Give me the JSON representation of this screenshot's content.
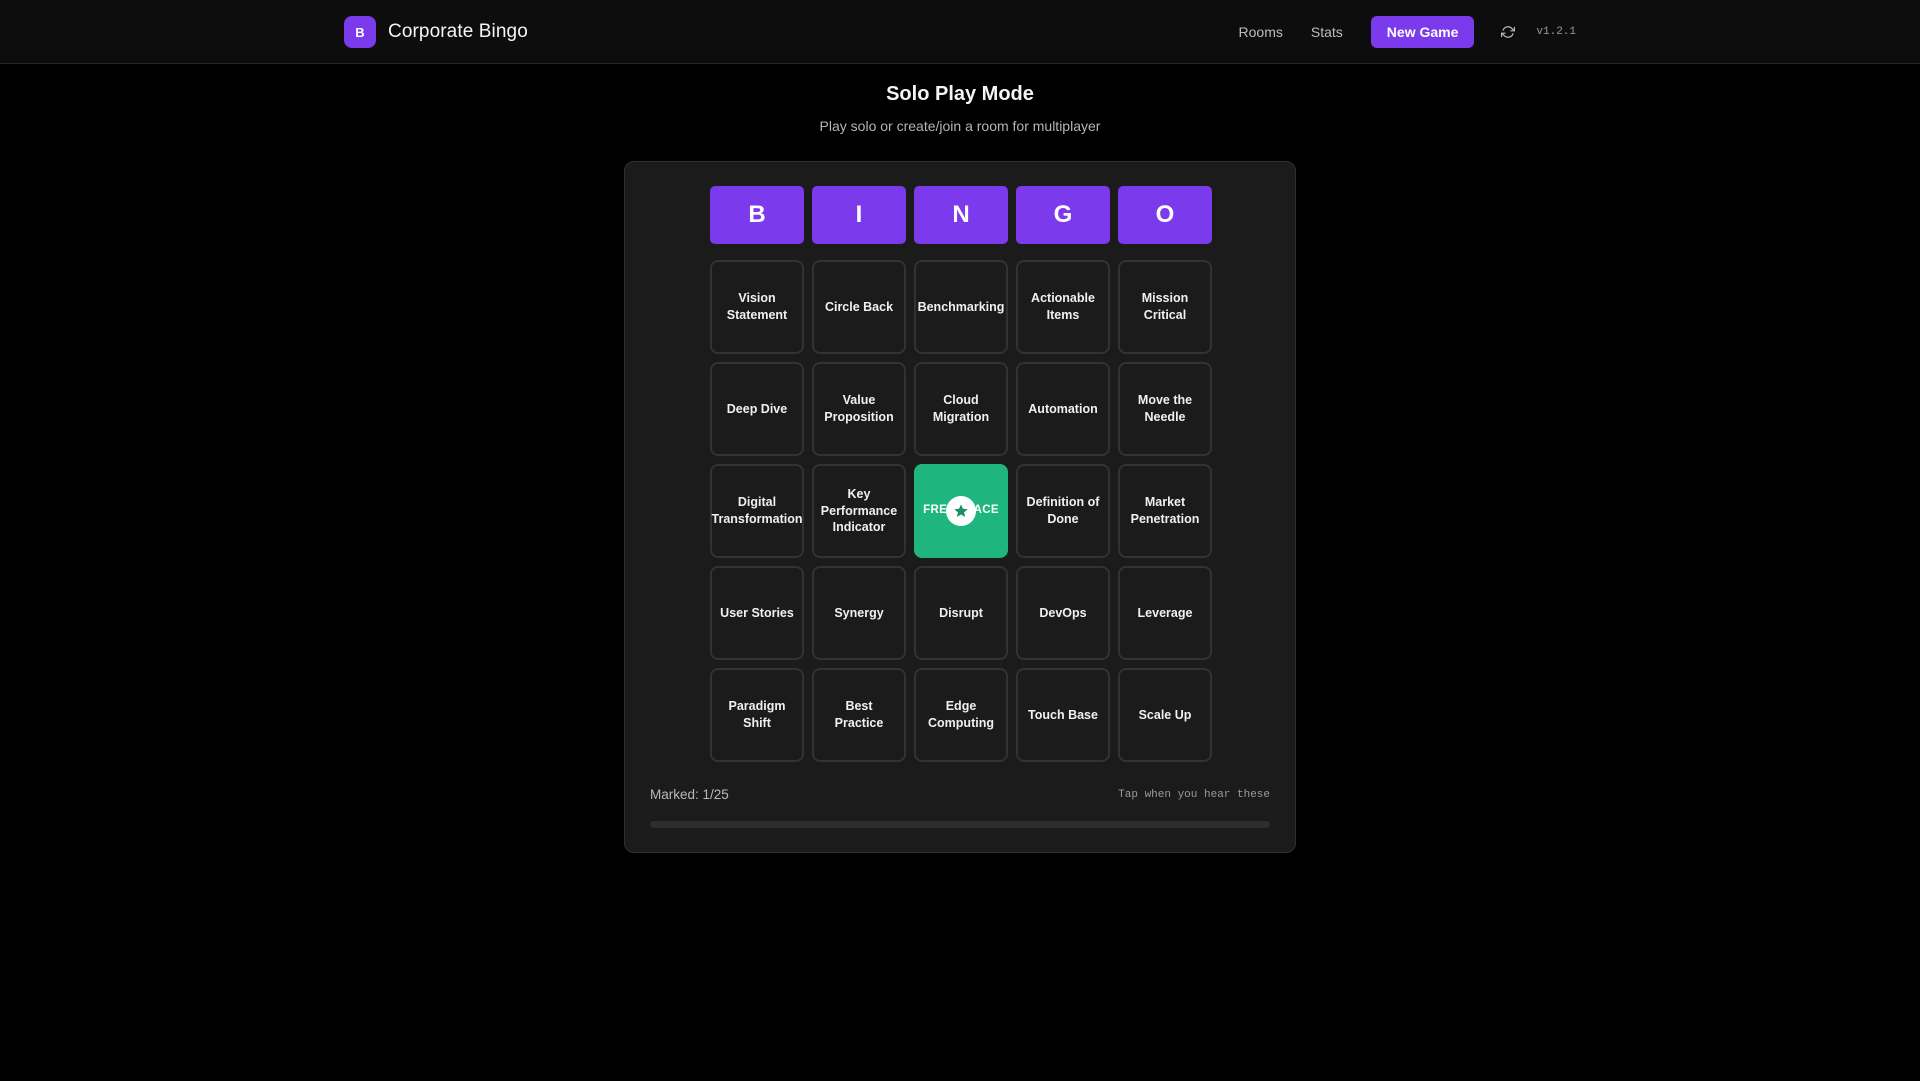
{
  "header": {
    "logo_letter": "B",
    "app_title": "Corporate Bingo",
    "nav": {
      "rooms": "Rooms",
      "stats": "Stats",
      "new_game": "New Game",
      "refresh_icon": "refresh-icon",
      "version": "v1.2.1"
    }
  },
  "page": {
    "title": "Solo Play Mode",
    "subtitle": "Play solo or create/join a room for multiplayer"
  },
  "board": {
    "letters": [
      "B",
      "I",
      "N",
      "G",
      "O"
    ],
    "cells": [
      {
        "label": "Vision Statement",
        "marked": false
      },
      {
        "label": "Circle Back",
        "marked": false
      },
      {
        "label": "Benchmarking",
        "marked": false
      },
      {
        "label": "Actionable Items",
        "marked": false
      },
      {
        "label": "Mission Critical",
        "marked": false
      },
      {
        "label": "Deep Dive",
        "marked": false
      },
      {
        "label": "Value Proposition",
        "marked": false
      },
      {
        "label": "Cloud Migration",
        "marked": false
      },
      {
        "label": "Automation",
        "marked": false
      },
      {
        "label": "Move the Needle",
        "marked": false
      },
      {
        "label": "Digital Transformation",
        "marked": false
      },
      {
        "label": "Key Performance Indicator",
        "marked": false
      },
      {
        "label": "FREE SPACE",
        "marked": true,
        "free": true,
        "icon": "star-icon"
      },
      {
        "label": "Definition of Done",
        "marked": false
      },
      {
        "label": "Market Penetration",
        "marked": false
      },
      {
        "label": "User Stories",
        "marked": false
      },
      {
        "label": "Synergy",
        "marked": false
      },
      {
        "label": "Disrupt",
        "marked": false
      },
      {
        "label": "DevOps",
        "marked": false
      },
      {
        "label": "Leverage",
        "marked": false
      },
      {
        "label": "Paradigm Shift",
        "marked": false
      },
      {
        "label": "Best Practice",
        "marked": false
      },
      {
        "label": "Edge Computing",
        "marked": false
      },
      {
        "label": "Touch Base",
        "marked": false
      },
      {
        "label": "Scale Up",
        "marked": false
      }
    ],
    "marked_text": "Marked: 1/25",
    "hint": "Tap when you hear these",
    "progress_percent": 0
  },
  "colors": {
    "accent": "#7c3aed",
    "free_cell": "#1fb57f",
    "background": "#000000",
    "card": "#1b1b1b"
  }
}
